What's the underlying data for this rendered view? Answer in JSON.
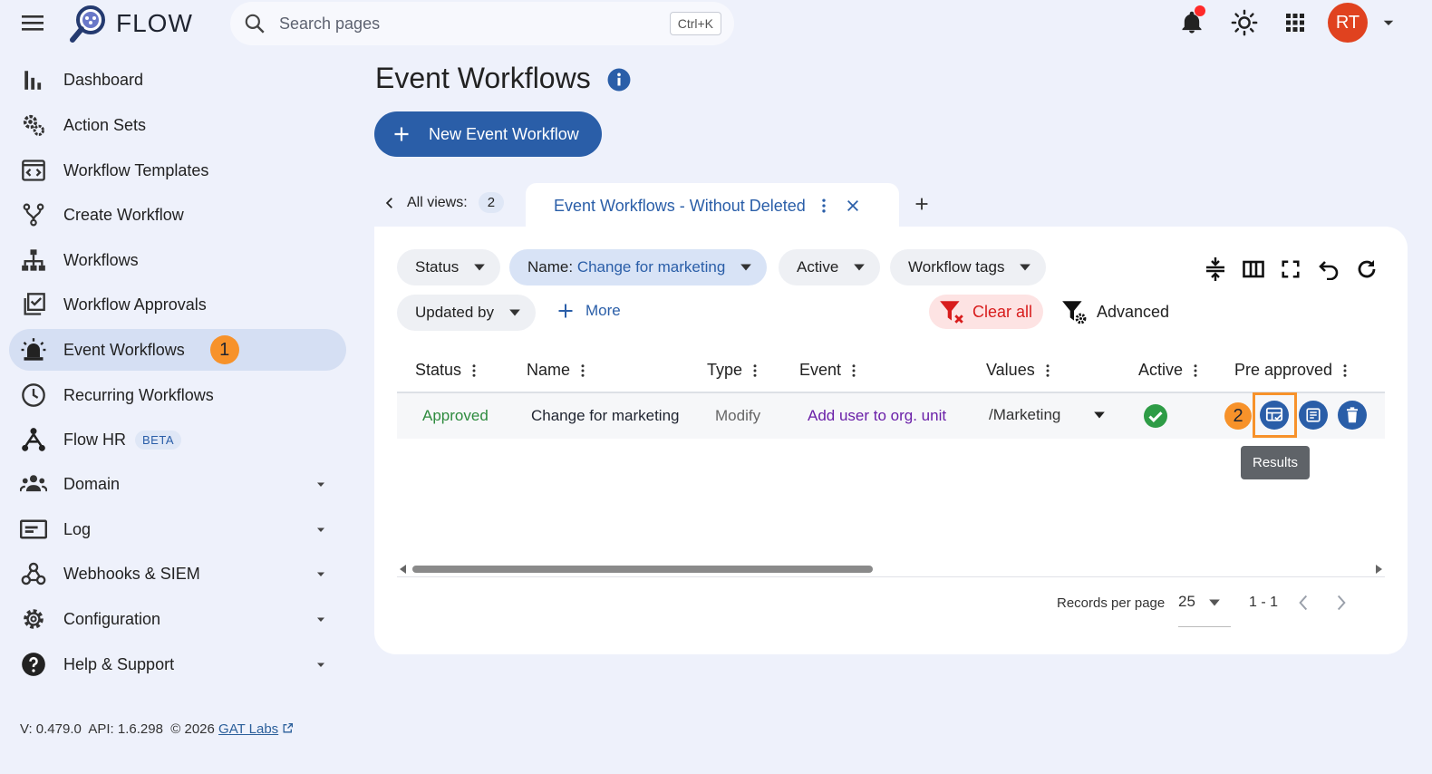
{
  "app": {
    "name": "FLOW"
  },
  "search": {
    "placeholder": "Search pages",
    "shortcut": "Ctrl+K"
  },
  "user": {
    "initials": "RT"
  },
  "sidebar": {
    "items": [
      {
        "label": "Dashboard",
        "icon": "bar-chart-icon"
      },
      {
        "label": "Action Sets",
        "icon": "gears-icon"
      },
      {
        "label": "Workflow Templates",
        "icon": "template-icon"
      },
      {
        "label": "Create Workflow",
        "icon": "fork-icon"
      },
      {
        "label": "Workflows",
        "icon": "sitemap-icon"
      },
      {
        "label": "Workflow Approvals",
        "icon": "approval-icon"
      },
      {
        "label": "Event Workflows",
        "icon": "alarm-light-icon",
        "badge": "1"
      },
      {
        "label": "Recurring Workflows",
        "icon": "clock-icon"
      },
      {
        "label": "Flow HR",
        "icon": "hr-icon",
        "tag": "BETA"
      },
      {
        "label": "Domain",
        "icon": "people-icon"
      },
      {
        "label": "Log",
        "icon": "log-icon"
      },
      {
        "label": "Webhooks & SIEM",
        "icon": "webhook-icon"
      },
      {
        "label": "Configuration",
        "icon": "gear-icon"
      },
      {
        "label": "Help & Support",
        "icon": "help-icon"
      }
    ]
  },
  "footer": {
    "version": "V: 0.479.0",
    "api": "API: 1.6.298",
    "copyright": "© 2026",
    "link": "GAT Labs"
  },
  "page": {
    "title": "Event Workflows",
    "new_button": "New Event Workflow",
    "views_label": "All views:",
    "views_count": "2",
    "active_tab": "Event Workflows - Without Deleted"
  },
  "filters": {
    "status": "Status",
    "name_key": "Name:",
    "name_value": "Change for marketing",
    "active": "Active",
    "workflow_tags": "Workflow tags",
    "updated_by": "Updated by",
    "more": "More",
    "clear_all": "Clear all",
    "advanced": "Advanced"
  },
  "table": {
    "columns": [
      "Status",
      "Name",
      "Type",
      "Event",
      "Values",
      "Active",
      "Pre approved"
    ],
    "rows": [
      {
        "status": "Approved",
        "name": "Change for marketing",
        "type": "Modify",
        "event": "Add user to org. unit",
        "values": "/Marketing",
        "badge": "2"
      }
    ],
    "tooltip": "Results"
  },
  "pagination": {
    "label": "Records per page",
    "per_page": "25",
    "range": "1 - 1"
  },
  "colors": {
    "primary": "#2a5ea8",
    "accent": "#f7922a",
    "danger": "#d81c1c",
    "success": "#2e8b3e"
  }
}
